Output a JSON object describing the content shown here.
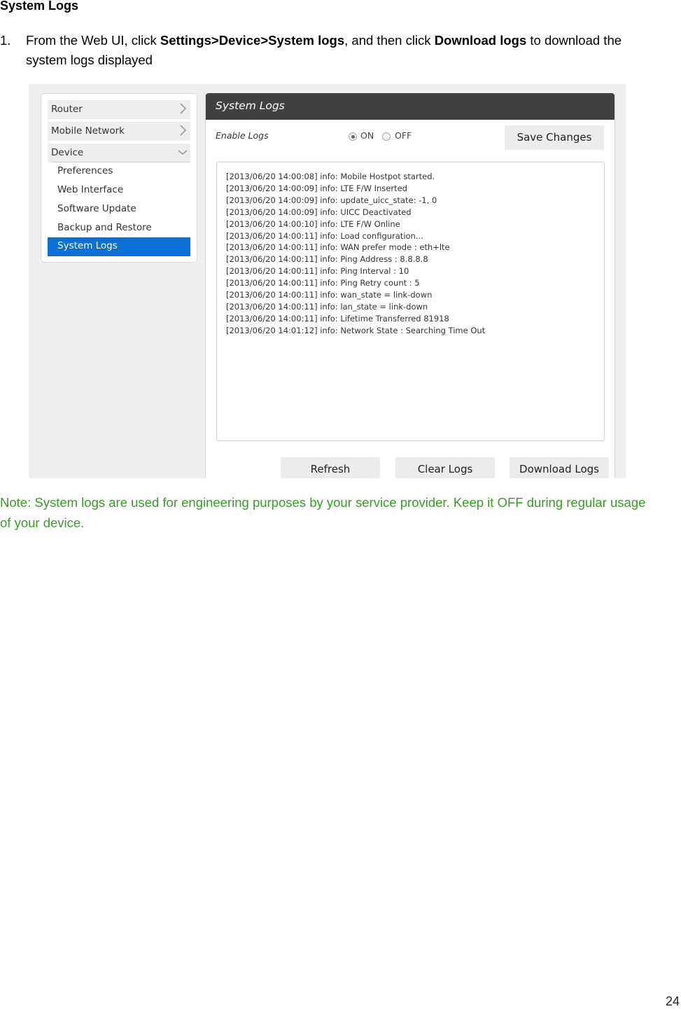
{
  "document": {
    "heading": "System Logs",
    "step": {
      "number": "1.",
      "text_1": "From the Web UI, click ",
      "bold_1": "Settings>Device>System logs",
      "text_2": ", and then click ",
      "bold_2": "Download logs",
      "text_3": " to download the system logs displayed"
    },
    "note": "Note: System logs are used for engineering purposes by your service provider. Keep it OFF during regular usage of your device.",
    "page_number": "24",
    "note_color": "#3a9a2a"
  },
  "screenshot": {
    "sidebar": {
      "sections": [
        {
          "label": "Router",
          "icon": "chevron-right-icon"
        },
        {
          "label": "Mobile Network",
          "icon": "chevron-right-icon"
        },
        {
          "label": "Device",
          "icon": "chevron-down-icon"
        }
      ],
      "sub_items": [
        {
          "label": "Preferences",
          "active": false
        },
        {
          "label": "Web Interface",
          "active": false
        },
        {
          "label": "Software Update",
          "active": false
        },
        {
          "label": "Backup and Restore",
          "active": false
        },
        {
          "label": "System Logs",
          "active": true
        }
      ],
      "active_color": "#0a6fd6"
    },
    "panel": {
      "title": "System Logs",
      "enable_logs_label": "Enable Logs",
      "radio_on_label": "ON",
      "radio_off_label": "OFF",
      "selected": "ON",
      "save_button": "Save Changes",
      "log_lines": [
        "[2013/06/20 14:00:08] info: Mobile Hostpot started.",
        "[2013/06/20 14:00:09] info: LTE F/W Inserted",
        "[2013/06/20 14:00:09] info: update_uicc_state: -1, 0",
        "[2013/06/20 14:00:09] info: UICC Deactivated",
        "[2013/06/20 14:00:10] info: LTE F/W Online",
        "[2013/06/20 14:00:11] info: Load configuration...",
        "[2013/06/20 14:00:11] info: WAN prefer mode : eth+lte",
        "[2013/06/20 14:00:11] info: Ping Address : 8.8.8.8",
        "[2013/06/20 14:00:11] info: Ping Interval : 10",
        "[2013/06/20 14:00:11] info: Ping Retry count : 5",
        "[2013/06/20 14:00:11] info: wan_state = link-down",
        "[2013/06/20 14:00:11] info: lan_state = link-down",
        "[2013/06/20 14:00:11] info: Lifetime Transferred 81918",
        "[2013/06/20 14:01:12] info: Network State : Searching Time Out"
      ],
      "refresh_button": "Refresh",
      "clear_button": "Clear Logs",
      "download_button": "Download Logs"
    }
  }
}
